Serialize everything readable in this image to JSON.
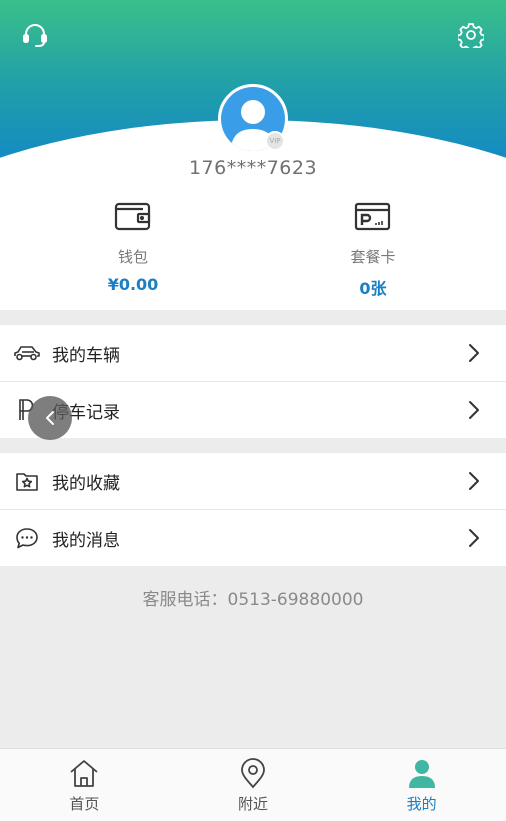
{
  "header": {
    "phone": "176****7623",
    "vip_badge": "VIP"
  },
  "stats": [
    {
      "label": "钱包",
      "value": "¥0.00",
      "icon": "wallet-icon"
    },
    {
      "label": "套餐卡",
      "value": "0张",
      "icon": "parking-card-icon"
    }
  ],
  "menu": {
    "group1": [
      {
        "label": "我的车辆",
        "icon": "car-icon"
      },
      {
        "label": "停车记录",
        "icon": "parking-record-icon"
      }
    ],
    "group2": [
      {
        "label": "我的收藏",
        "icon": "favorites-folder-icon"
      },
      {
        "label": "我的消息",
        "icon": "message-bubble-icon"
      }
    ]
  },
  "service": "客服电话：0513-69880000",
  "tabs": [
    {
      "label": "首页",
      "icon": "home-icon",
      "active": false
    },
    {
      "label": "附近",
      "icon": "location-pin-icon",
      "active": false
    },
    {
      "label": "我的",
      "icon": "user-icon",
      "active": true
    }
  ],
  "colors": {
    "accent": "#1a7fc4",
    "header_top": "#39c08a",
    "header_bottom": "#1389c5",
    "avatar": "#3a9de8",
    "active_tab_icon": "#3fb7a2"
  }
}
